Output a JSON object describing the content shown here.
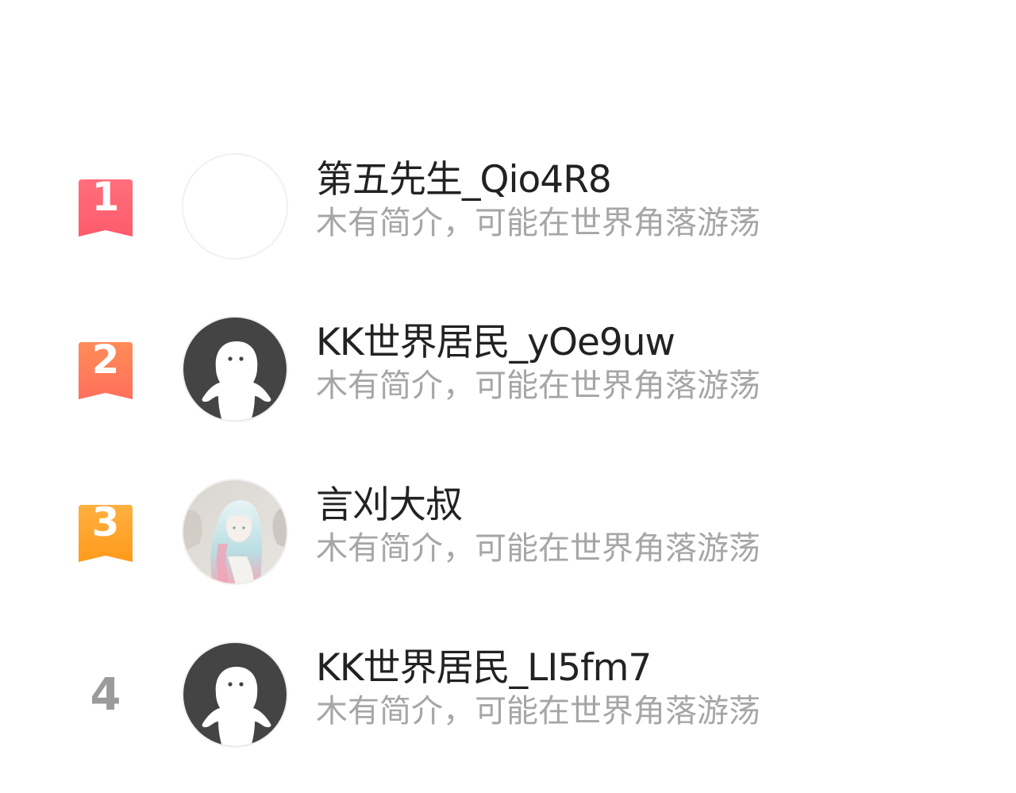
{
  "users": [
    {
      "rank": "1",
      "name": "第五先生_Qio4R8",
      "bio": "木有简介，可能在世界角落游荡",
      "avatar": "blank-avatar",
      "badge_color_top": "#ff6b78",
      "badge_color_bottom": "#ff5a6a"
    },
    {
      "rank": "2",
      "name": "KK世界居民_yOe9uw",
      "bio": "木有简介，可能在世界角落游荡",
      "avatar": "default-ghost-avatar",
      "badge_color_top": "#ff8a55",
      "badge_color_bottom": "#ff6f5a"
    },
    {
      "rank": "3",
      "name": "言刈大叔",
      "bio": "木有简介，可能在世界角落游荡",
      "avatar": "anime-girl-avatar",
      "badge_color_top": "#ffad3a",
      "badge_color_bottom": "#ff9a1e"
    },
    {
      "rank": "4",
      "name": "KK世界居民_LI5fm7",
      "bio": "木有简介，可能在世界角落游荡",
      "avatar": "default-ghost-avatar"
    }
  ]
}
